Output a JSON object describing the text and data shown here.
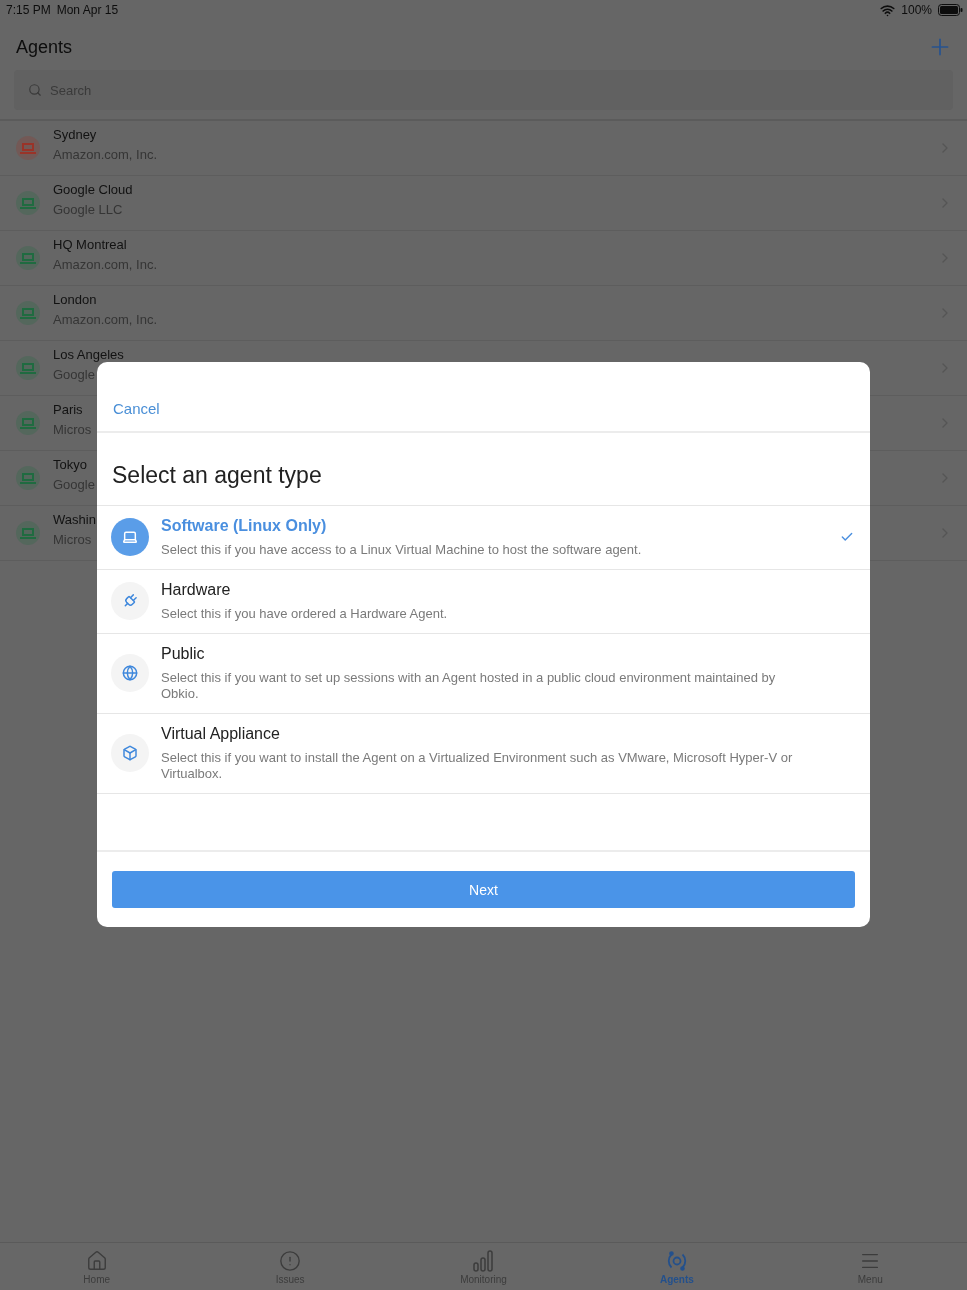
{
  "status_bar": {
    "time": "7:15 PM",
    "date": "Mon Apr 15",
    "battery": "100%"
  },
  "header": {
    "title": "Agents"
  },
  "search": {
    "placeholder": "Search"
  },
  "agents": [
    {
      "name": "Sydney",
      "provider": "Amazon.com, Inc.",
      "color": "#9a3328"
    },
    {
      "name": "Google Cloud",
      "provider": "Google LLC",
      "color": "#1f6b40"
    },
    {
      "name": "HQ Montreal",
      "provider": "Amazon.com, Inc.",
      "color": "#1f6b40"
    },
    {
      "name": "London",
      "provider": "Amazon.com, Inc.",
      "color": "#1f6b40"
    },
    {
      "name": "Los Angeles",
      "provider": "Google",
      "color": "#1f6b40"
    },
    {
      "name": "Paris",
      "provider": "Micros",
      "color": "#1f6b40"
    },
    {
      "name": "Tokyo",
      "provider": "Google",
      "color": "#1f6b40"
    },
    {
      "name": "Washin",
      "provider": "Micros",
      "color": "#1f6b40"
    }
  ],
  "modal": {
    "cancel": "Cancel",
    "title": "Select an agent type",
    "options": [
      {
        "kind": "software",
        "title": "Software (Linux Only)",
        "description": "Select this if you have access to a Linux Virtual Machine to host the software agent.",
        "selected": true
      },
      {
        "kind": "hardware",
        "title": "Hardware",
        "description": "Select this if you have ordered a Hardware Agent.",
        "selected": false
      },
      {
        "kind": "public",
        "title": "Public",
        "description": "Select this if you want to set up sessions with an Agent hosted in a public cloud environment maintained by Obkio.",
        "selected": false
      },
      {
        "kind": "virtual",
        "title": "Virtual Appliance",
        "description": "Select this if you want to install the Agent on a Virtualized Environment such as VMware, Microsoft Hyper-V or Virtualbox.",
        "selected": false
      }
    ],
    "next_button": "Next"
  },
  "tab_bar": [
    {
      "kind": "home",
      "label": "Home",
      "selected": false
    },
    {
      "kind": "issues",
      "label": "Issues",
      "selected": false
    },
    {
      "kind": "monitoring",
      "label": "Monitoring",
      "selected": false
    },
    {
      "kind": "agents",
      "label": "Agents",
      "selected": true
    },
    {
      "kind": "menu",
      "label": "Menu",
      "selected": false
    }
  ]
}
